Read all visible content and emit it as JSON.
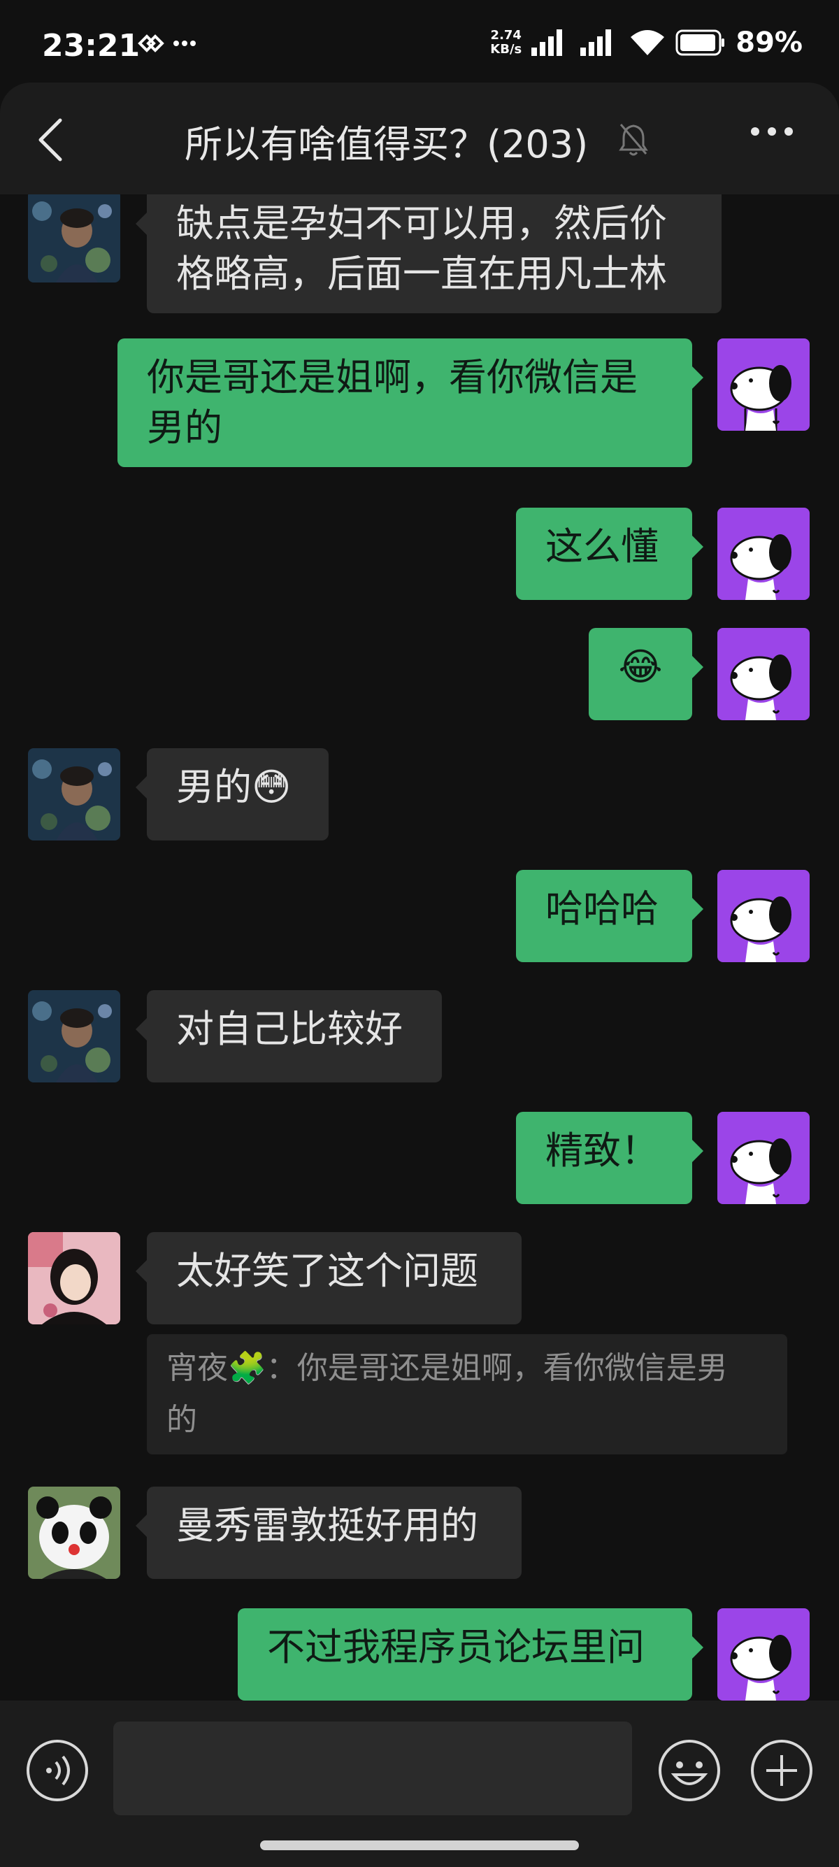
{
  "status_bar": {
    "time": "23:21",
    "net_speed_value": "2.74",
    "net_speed_unit": "KB/s",
    "battery": "89%"
  },
  "header": {
    "title": "所以有啥值得买？(203)"
  },
  "messages": [
    {
      "side": "in",
      "avatar": "avatar-man-in-garden",
      "text_line1": "缺点是孕妇不可以用，然后价",
      "text_line2": "格略高，后面一直在用凡士林"
    },
    {
      "side": "out",
      "text_line1": "你是哥还是姐啊，看你微信是",
      "text_line2": "男的"
    },
    {
      "side": "out",
      "text": "这么懂"
    },
    {
      "side": "out",
      "emoji": "😂"
    },
    {
      "side": "in",
      "text": "男的😳"
    },
    {
      "side": "out",
      "text": "哈哈哈"
    },
    {
      "side": "in",
      "text": "对自己比较好"
    },
    {
      "side": "out",
      "text": "精致！"
    },
    {
      "side": "in",
      "avatar": "avatar-girl",
      "text": "太好笑了这个问题"
    },
    {
      "quote_line1": "宵夜🧩：你是哥还是姐啊，看你微信是男",
      "quote_line2": "的"
    },
    {
      "side": "in",
      "avatar": "avatar-panda",
      "text": "曼秀雷敦挺好用的"
    },
    {
      "side": "out",
      "text": "不过我程序员论坛里问"
    }
  ],
  "colors": {
    "background": "#111111",
    "incoming_bubble": "#2c2c2c",
    "outgoing_bubble": "#3fb46e",
    "self_avatar_bg": "#9b45e8"
  }
}
